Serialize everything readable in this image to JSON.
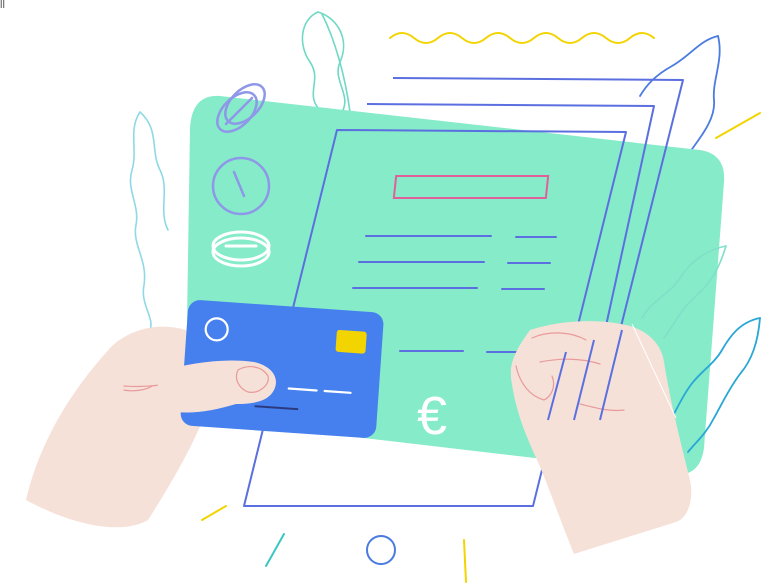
{
  "corner_glyph": "ll",
  "document": {
    "currency_symbol": "€"
  },
  "colors": {
    "mint_panel": "#86EBC8",
    "paper_outline": "#5B6FE0",
    "title_bar": "#E0609A",
    "card_blue": "#4580EE",
    "card_chip": "#F2D400",
    "skin": "#F6E1D9",
    "skin_line": "#E89A9A",
    "coin_outline": "#8E97E8",
    "leaf_teal": "#6FD9C5",
    "leaf_blue": "#4A7BE0",
    "leaf_cyan": "#29A7D6",
    "accent_yellow": "#F2D400"
  },
  "icons": [
    "coin-stack-icon",
    "clock-coin-icon",
    "coin-icon",
    "euro-icon",
    "credit-card-icon",
    "ring-icon"
  ]
}
